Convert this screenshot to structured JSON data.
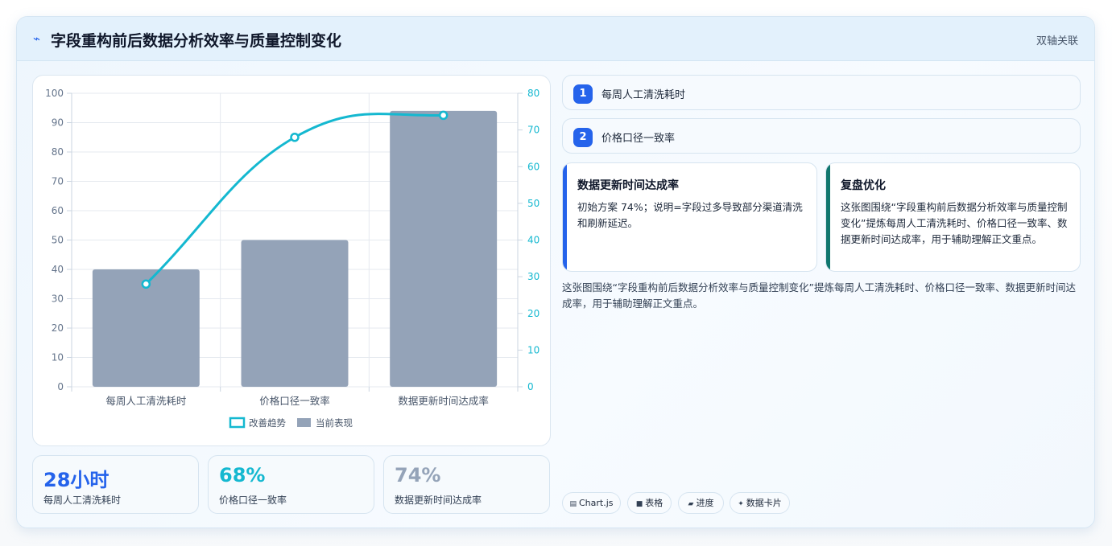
{
  "header": {
    "title": "字段重构前后数据分析效率与质量控制变化",
    "tag": "双轴关联",
    "icon": "lightning-icon"
  },
  "chart_data": {
    "type": "bar",
    "categories": [
      "每周人工清洗耗时",
      "价格口径一致率",
      "数据更新时间达成率"
    ],
    "series": [
      {
        "name": "当前表现",
        "type": "bar",
        "axis": "left",
        "color": "#94a3b8",
        "values": [
          40,
          50,
          94
        ]
      },
      {
        "name": "改善趋势",
        "type": "line",
        "axis": "right",
        "color": "#14b8d0",
        "values": [
          28,
          68,
          74
        ]
      }
    ],
    "ylim": [
      0,
      100
    ],
    "ylim_right": [
      0,
      80
    ],
    "yticks": [
      0,
      10,
      20,
      30,
      40,
      50,
      60,
      70,
      80,
      90,
      100
    ],
    "yticks_right": [
      0,
      10,
      20,
      30,
      40,
      50,
      60,
      70,
      80
    ],
    "legend_position": "bottom",
    "grid": true
  },
  "stats": [
    {
      "value": "28小时",
      "label": "每周人工清洗耗时",
      "color": "#2563eb"
    },
    {
      "value": "68%",
      "label": "价格口径一致率",
      "color": "#14b8d0"
    },
    {
      "value": "74%",
      "label": "数据更新时间达成率",
      "color": "#94a3b8"
    }
  ],
  "steps": [
    {
      "num": "1",
      "text": "每周人工清洗耗时"
    },
    {
      "num": "2",
      "text": "价格口径一致率"
    }
  ],
  "notes": [
    {
      "title": "数据更新时间达成率",
      "body": "初始方案 74%；说明=字段过多导致部分渠道清洗和刷新延迟。",
      "accent": "#2563eb"
    },
    {
      "title": "复盘优化",
      "body": "这张图围绕“字段重构前后数据分析效率与质量控制变化”提炼每周人工清洗耗时、价格口径一致率、数据更新时间达成率，用于辅助理解正文重点。",
      "accent": "#0f766e"
    }
  ],
  "summary": "这张图围绕“字段重构前后数据分析效率与质量控制变化”提炼每周人工清洗耗时、价格口径一致率、数据更新时间达成率，用于辅助理解正文重点。",
  "chips": [
    {
      "icon": "chart-icon",
      "glyph": "▤",
      "label": "Chart.js"
    },
    {
      "icon": "table-icon",
      "glyph": "■",
      "label": "表格"
    },
    {
      "icon": "progress-icon",
      "glyph": "▰",
      "label": "进度"
    },
    {
      "icon": "sparkle-icon",
      "glyph": "✦",
      "label": "数据卡片"
    }
  ]
}
